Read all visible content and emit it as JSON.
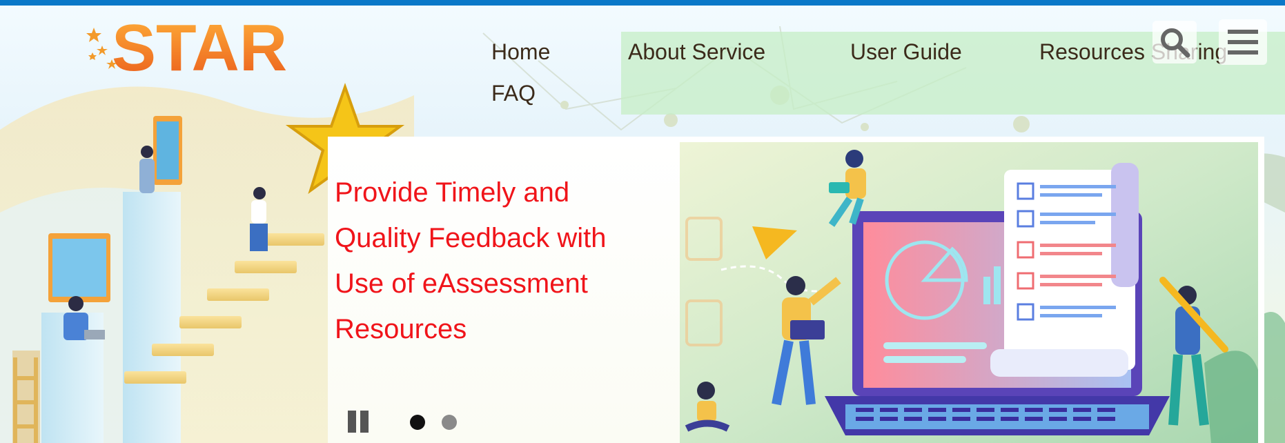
{
  "brand": {
    "logo_text": "STAR",
    "primary_color": "#0a78c8",
    "logo_color": "#f07a1a"
  },
  "nav": {
    "items": [
      {
        "label": "Home"
      },
      {
        "label": "About Service"
      },
      {
        "label": "User Guide"
      },
      {
        "label": "Resources Sharing"
      },
      {
        "label": "FAQ"
      }
    ],
    "search_icon": "search-icon",
    "menu_icon": "hamburger-menu-icon"
  },
  "banner": {
    "headline_lines": [
      "Provide Timely and",
      "Quality Feedback with",
      "Use of eAssessment",
      "Resources"
    ],
    "headline_color": "#f0141a",
    "pause_icon": "pause-icon",
    "slide_count": 2,
    "active_slide": 1
  }
}
